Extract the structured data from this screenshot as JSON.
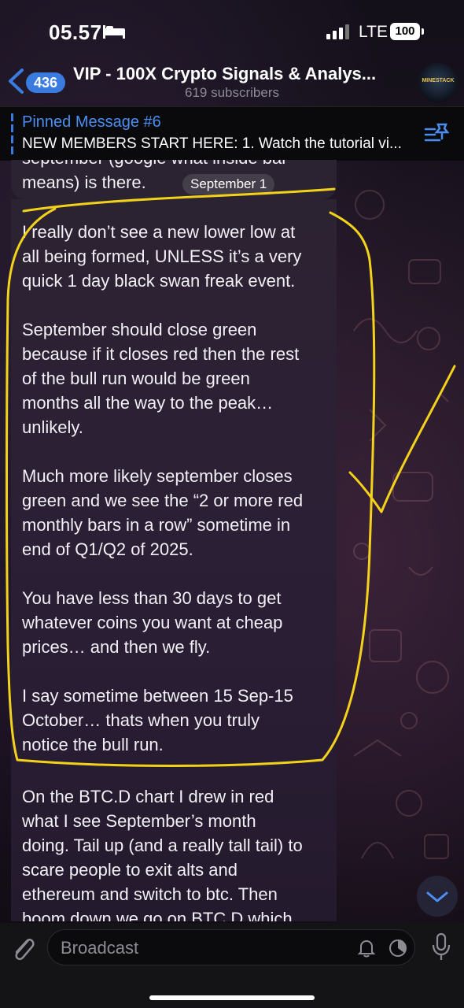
{
  "status_bar": {
    "time": "05.57",
    "network": "LTE",
    "battery": "100"
  },
  "header": {
    "back_badge": "436",
    "title": "VIP - 100X Crypto Signals & Analys...",
    "subtitle": "619 subscribers",
    "avatar_text": "MINESTACK"
  },
  "pinned": {
    "title": "Pinned Message #6",
    "text": "NEW MEMBERS START HERE: 1. Watch the tutorial vi..."
  },
  "messages": {
    "prev_cut_line": "september (google what inside bar",
    "prev_last_line": "means) is there.",
    "date_pill": "September 1",
    "main_text": "I really don’t see a new lower low at\nall being formed, UNLESS it’s a very\nquick 1 day black swan freak event.\n\nSeptember should close green\nbecause if it closes red then the rest\nof the bull run would be green\nmonths all the way to the peak…\nunlikely.\n\nMuch more likely september closes\ngreen and we see the “2 or more red\nmonthly bars in a row” sometime in\nend of Q1/Q2 of 2025.\n\nYou have less than 30 days to get\nwhatever coins you want at cheap\nprices… and then we fly.\n\nI say sometime between 15 Sep-15\nOctober… thats when you truly\nnotice the bull run.",
    "next_text": "On the BTC.D chart I drew in red\nwhat I see September’s month\ndoing. Tail up (and a really tall tail) to\nscare people to exit alts and\nethereum and switch to btc. Then\nboom down we go on BTC.D which"
  },
  "input": {
    "placeholder": "Broadcast"
  },
  "colors": {
    "accent": "#3a7be0",
    "annotation": "#f2d21b"
  }
}
